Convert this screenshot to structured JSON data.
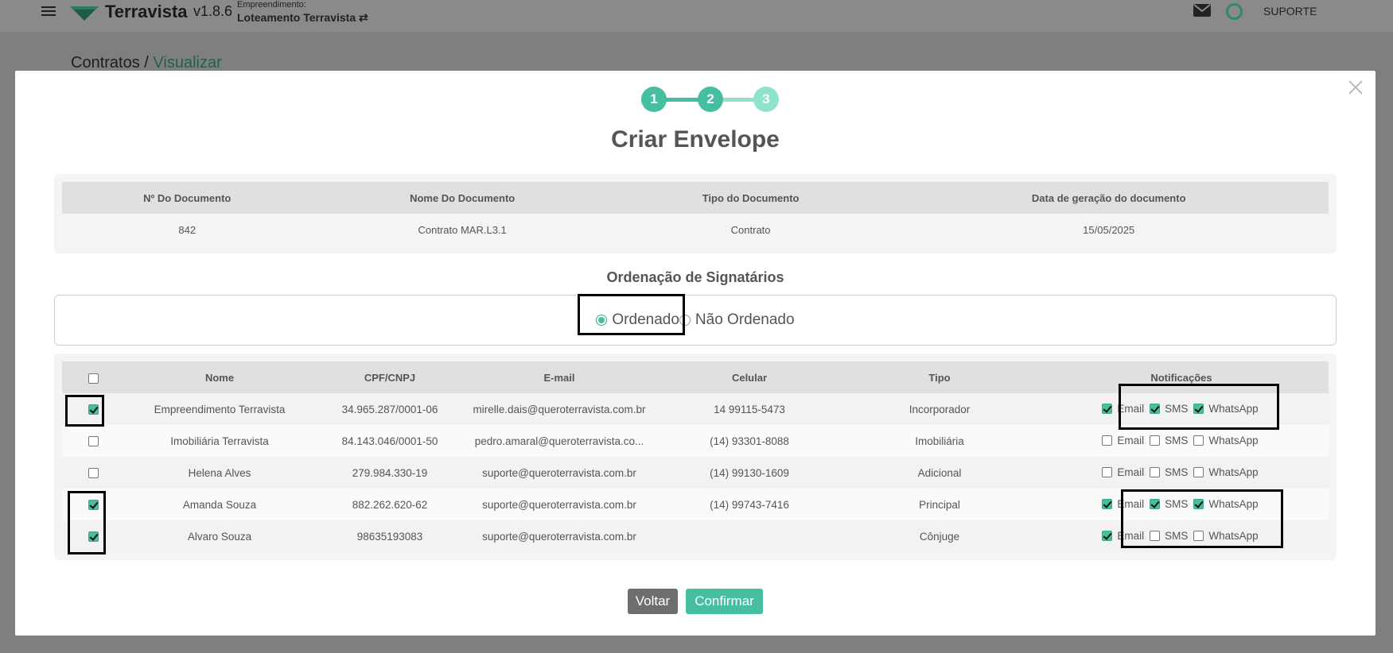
{
  "header": {
    "brand": "Terravista",
    "version": "v1.8.6",
    "empreendimento_label": "Empreendimento:",
    "empreendimento_name": "Loteamento Terravista ⇄",
    "support": "SUPORTE"
  },
  "breadcrumb": {
    "root": "Contratos",
    "separator": "/",
    "current": "Visualizar"
  },
  "modal": {
    "steps": [
      "1",
      "2",
      "3"
    ],
    "current_step": 2,
    "title": "Criar Envelope",
    "document": {
      "headers": [
        "Nº Do Documento",
        "Nome Do Documento",
        "Tipo do Documento",
        "Data de geração do documento"
      ],
      "row": [
        "842",
        "Contrato MAR.L3.1",
        "Contrato",
        "15/05/2025"
      ]
    },
    "ordering": {
      "title": "Ordenação de Signatários",
      "options": [
        "Ordenado",
        "Não Ordenado"
      ],
      "selected": "Ordenado"
    },
    "signatories": {
      "headers": [
        "Nome",
        "CPF/CNPJ",
        "E-mail",
        "Celular",
        "Tipo",
        "Notificações"
      ],
      "notification_labels": [
        "Email",
        "SMS",
        "WhatsApp"
      ],
      "rows": [
        {
          "checked": true,
          "nome": "Empreendimento Terravista",
          "cpf": "34.965.287/0001-06",
          "email": "mirelle.dais@queroterravista.com.br",
          "celular": "14 99115-5473",
          "tipo": "Incorporador",
          "notif": [
            true,
            true,
            true
          ]
        },
        {
          "checked": false,
          "nome": "Imobiliária Terravista",
          "cpf": "84.143.046/0001-50",
          "email": "pedro.amaral@queroterravista.co...",
          "celular": "(14) 93301-8088",
          "tipo": "Imobiliária",
          "notif": [
            false,
            false,
            false
          ]
        },
        {
          "checked": false,
          "nome": "Helena Alves",
          "cpf": "279.984.330-19",
          "email": "suporte@queroterravista.com.br",
          "celular": "(14) 99130-1609",
          "tipo": "Adicional",
          "notif": [
            false,
            false,
            false
          ]
        },
        {
          "checked": true,
          "nome": "Amanda Souza",
          "cpf": "882.262.620-62",
          "email": "suporte@queroterravista.com.br",
          "celular": "(14) 99743-7416",
          "tipo": "Principal",
          "notif": [
            true,
            true,
            true
          ]
        },
        {
          "checked": true,
          "nome": "Alvaro Souza",
          "cpf": "98635193083",
          "email": "suporte@queroterravista.com.br",
          "celular": "",
          "tipo": "Cônjuge",
          "notif": [
            true,
            false,
            false
          ]
        }
      ]
    },
    "buttons": {
      "back": "Voltar",
      "confirm": "Confirmar"
    }
  },
  "colors": {
    "accent": "#46bfa0",
    "step_done": "#46bfa0",
    "step_pending": "#8fe3cc",
    "button_back": "#6e6e6e"
  }
}
